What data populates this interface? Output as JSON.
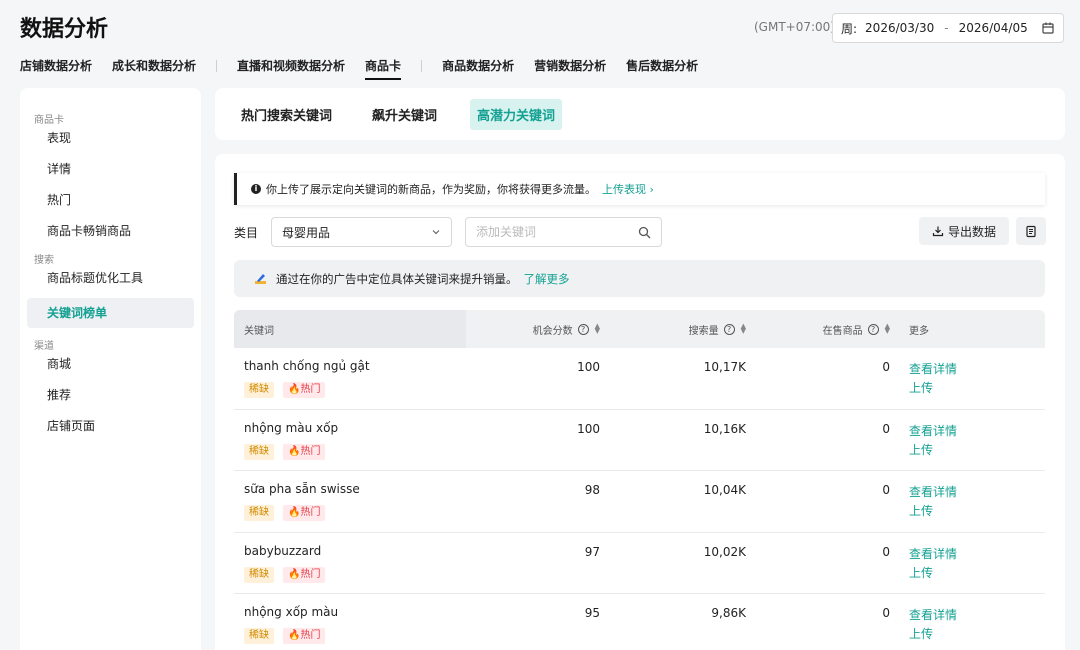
{
  "page_title": "数据分析",
  "timezone": "(GMT+07:00)",
  "date_range": {
    "label": "周:",
    "start": "2026/03/30",
    "separator": "-",
    "end": "2026/04/05"
  },
  "topnav": [
    "店铺数据分析",
    "成长和数据分析",
    "直播和视频数据分析",
    "商品卡",
    "商品数据分析",
    "营销数据分析",
    "售后数据分析"
  ],
  "sidebar": {
    "group1": "商品卡",
    "items1": [
      "表现",
      "详情",
      "热门",
      "商品卡畅销商品"
    ],
    "group2": "搜索",
    "items2": [
      "商品标题优化工具",
      "关键词榜单"
    ],
    "group3": "渠道",
    "items3": [
      "商城",
      "推荐",
      "店铺页面"
    ]
  },
  "tabs": [
    "热门搜索关键词",
    "飙升关键词",
    "高潜力关键词"
  ],
  "notice": {
    "text": "你上传了展示定向关键词的新商品，作为奖励，你将获得更多流量。",
    "link": "上传表现 ›"
  },
  "filters": {
    "category_label": "类目",
    "category_value": "母婴用品",
    "search_placeholder": "添加关键词",
    "export_label": "导出数据"
  },
  "banner": {
    "text": "通过在你的广告中定位具体关键词来提升销量。",
    "link": "了解更多"
  },
  "table": {
    "headers": {
      "keyword": "关键词",
      "opportunity": "机会分数",
      "volume": "搜索量",
      "on_sale": "在售商品",
      "more": "更多"
    },
    "rows": [
      {
        "keyword": "thanh chống ngủ gật",
        "tags": [
          "稀缺",
          "热门"
        ],
        "opportunity": "100",
        "volume": "10,17K",
        "on_sale": "0",
        "actions": [
          "查看详情",
          "上传"
        ]
      },
      {
        "keyword": "nhộng màu xốp",
        "tags": [
          "稀缺",
          "热门"
        ],
        "opportunity": "100",
        "volume": "10,16K",
        "on_sale": "0",
        "actions": [
          "查看详情",
          "上传"
        ]
      },
      {
        "keyword": "sữa pha sẵn swisse",
        "tags": [
          "稀缺",
          "热门"
        ],
        "opportunity": "98",
        "volume": "10,04K",
        "on_sale": "0",
        "actions": [
          "查看详情",
          "上传"
        ]
      },
      {
        "keyword": "babybuzzard",
        "tags": [
          "稀缺",
          "热门"
        ],
        "opportunity": "97",
        "volume": "10,02K",
        "on_sale": "0",
        "actions": [
          "查看详情",
          "上传"
        ]
      },
      {
        "keyword": "nhộng xốp màu",
        "tags": [
          "稀缺",
          "热门"
        ],
        "opportunity": "95",
        "volume": "9,86K",
        "on_sale": "0",
        "actions": [
          "查看详情",
          "上传"
        ]
      }
    ]
  },
  "colors": {
    "accent": "#14a193",
    "rare_tag": "#d18a00",
    "hot_tag": "#e53b47"
  },
  "icons": [
    "calendar-icon",
    "info-icon",
    "chevron-down-icon",
    "search-icon",
    "download-icon",
    "document-icon",
    "pencil-icon",
    "help-icon",
    "sort-icon",
    "fire-icon"
  ]
}
